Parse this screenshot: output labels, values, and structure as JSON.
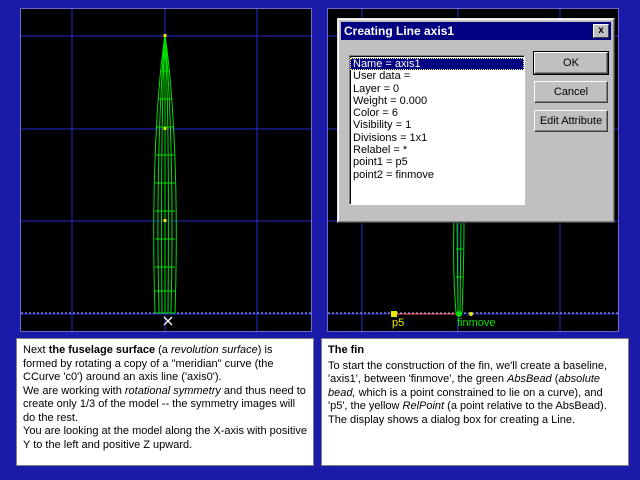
{
  "dialog": {
    "title": "Creating Line axis1",
    "close_glyph": "x",
    "attributes": [
      "Name = axis1",
      "User data =",
      "Layer = 0",
      "Weight = 0.000",
      "Color = 6",
      "Visibility = 1",
      "Divisions = 1x1",
      "Relabel = *",
      "point1 = p5",
      "point2 = finmove"
    ],
    "selected_index": 0,
    "ok_label": "OK",
    "cancel_label": "Cancel",
    "edit_label": "Edit Attribute"
  },
  "right_view": {
    "label_p5": "p5",
    "label_finmove": "finmove"
  },
  "panel_left": {
    "t1": "Next ",
    "t2": "the fuselage surface",
    "t3": " (a ",
    "t4": "revolution surface",
    "t5": ") is formed by rotating a copy of a \"meridian\" curve (the CCurve 'c0') around an axis line ('axis0').",
    "t6": "We are working with ",
    "t7": "rotational symmetry",
    "t8": " and thus need to create only 1/3 of the model -- the symmetry images will do the rest.",
    "t9": "You are looking at the model along the X-axis with positive Y to the left and positive Z upward."
  },
  "panel_right": {
    "title": "The fin",
    "t1": "To start the construction of the fin, we'll create a baseline, 'axis1', between 'finmove', the green ",
    "t2": "AbsBead",
    "t3": "  (",
    "t4": "absolute bead,",
    "t5": " which is a point constrained to lie on a curve), and 'p5', the yellow ",
    "t6": "RelPoint",
    "t7": " (a point relative to the AbsBead).",
    "t8": "The display shows a dialog box for creating a Line."
  },
  "colors": {
    "background": "#1a1aa8",
    "grid": "#2a2ad0",
    "curve": "#00e000",
    "point": "#e8e800",
    "title_bar": "#000080"
  }
}
